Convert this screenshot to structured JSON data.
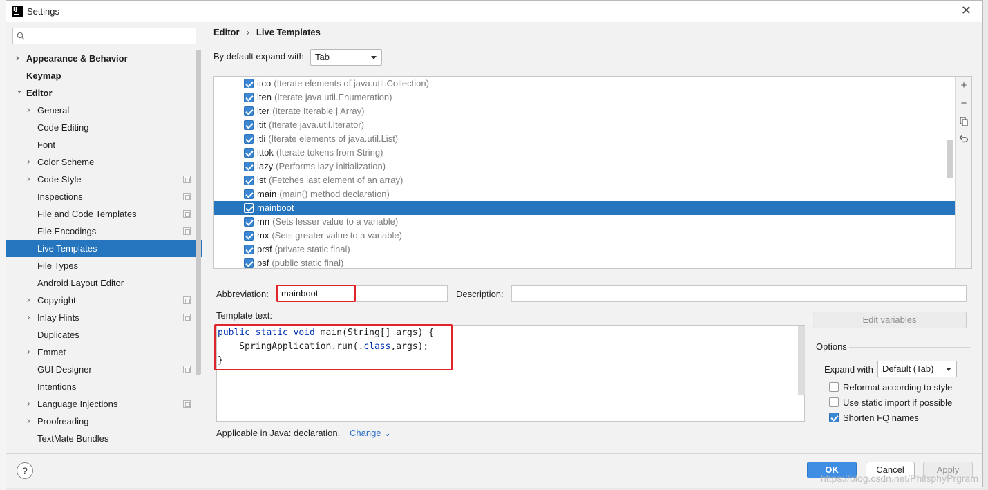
{
  "window": {
    "title": "Settings",
    "close_label": "✕"
  },
  "sidebar": {
    "search_placeholder": "",
    "items": [
      {
        "label": "Appearance & Behavior",
        "bold": true,
        "arrow": "›",
        "indent": 0
      },
      {
        "label": "Keymap",
        "bold": true,
        "arrow": "",
        "indent": 0
      },
      {
        "label": "Editor",
        "bold": true,
        "arrow": "⌄",
        "indent": 0
      },
      {
        "label": "General",
        "arrow": "›",
        "indent": 1
      },
      {
        "label": "Code Editing",
        "arrow": "",
        "indent": 1
      },
      {
        "label": "Font",
        "arrow": "",
        "indent": 1
      },
      {
        "label": "Color Scheme",
        "arrow": "›",
        "indent": 1
      },
      {
        "label": "Code Style",
        "arrow": "›",
        "indent": 1,
        "proj": true
      },
      {
        "label": "Inspections",
        "arrow": "",
        "indent": 1,
        "proj": true
      },
      {
        "label": "File and Code Templates",
        "arrow": "",
        "indent": 1,
        "proj": true
      },
      {
        "label": "File Encodings",
        "arrow": "",
        "indent": 1,
        "proj": true
      },
      {
        "label": "Live Templates",
        "arrow": "",
        "indent": 1,
        "selected": true
      },
      {
        "label": "File Types",
        "arrow": "",
        "indent": 1
      },
      {
        "label": "Android Layout Editor",
        "arrow": "",
        "indent": 1
      },
      {
        "label": "Copyright",
        "arrow": "›",
        "indent": 1,
        "proj": true
      },
      {
        "label": "Inlay Hints",
        "arrow": "›",
        "indent": 1,
        "proj": true
      },
      {
        "label": "Duplicates",
        "arrow": "",
        "indent": 1
      },
      {
        "label": "Emmet",
        "arrow": "›",
        "indent": 1
      },
      {
        "label": "GUI Designer",
        "arrow": "",
        "indent": 1,
        "proj": true
      },
      {
        "label": "Intentions",
        "arrow": "",
        "indent": 1
      },
      {
        "label": "Language Injections",
        "arrow": "›",
        "indent": 1,
        "proj": true
      },
      {
        "label": "Proofreading",
        "arrow": "›",
        "indent": 1
      },
      {
        "label": "TextMate Bundles",
        "arrow": "",
        "indent": 1
      }
    ]
  },
  "breadcrumb": {
    "parent": "Editor",
    "separator": "›",
    "current": "Live Templates"
  },
  "expand": {
    "label": "By default expand with",
    "value": "Tab"
  },
  "templates": [
    {
      "name": "itco",
      "desc": "(Iterate elements of java.util.Collection)",
      "checked": true
    },
    {
      "name": "iten",
      "desc": "(Iterate java.util.Enumeration)",
      "checked": true
    },
    {
      "name": "iter",
      "desc": "(Iterate Iterable | Array)",
      "checked": true
    },
    {
      "name": "itit",
      "desc": "(Iterate java.util.Iterator)",
      "checked": true
    },
    {
      "name": "itli",
      "desc": "(Iterate elements of java.util.List)",
      "checked": true
    },
    {
      "name": "ittok",
      "desc": "(Iterate tokens from String)",
      "checked": true
    },
    {
      "name": "lazy",
      "desc": "(Performs lazy initialization)",
      "checked": true
    },
    {
      "name": "lst",
      "desc": "(Fetches last element of an array)",
      "checked": true
    },
    {
      "name": "main",
      "desc": "(main() method declaration)",
      "checked": true
    },
    {
      "name": "mainboot",
      "desc": "",
      "checked": true,
      "selected": true
    },
    {
      "name": "mn",
      "desc": "(Sets lesser value to a variable)",
      "checked": true
    },
    {
      "name": "mx",
      "desc": "(Sets greater value to a variable)",
      "checked": true
    },
    {
      "name": "prsf",
      "desc": "(private static final)",
      "checked": true
    },
    {
      "name": "psf",
      "desc": "(public static final)",
      "checked": true
    }
  ],
  "list_tools": [
    "+",
    "−",
    "copy-icon",
    "revert-icon"
  ],
  "abbreviation": {
    "label": "Abbreviation:",
    "value": "mainboot"
  },
  "description": {
    "label": "Description:",
    "value": ""
  },
  "template_text": {
    "label": "Template text:",
    "lines": [
      {
        "kw": "public static void",
        "rest": " main(String[] args) {"
      },
      {
        "kw": "",
        "pre": "    SpringApplication.run(.",
        "kw2": "class",
        "rest": ",args);"
      },
      {
        "kw": "",
        "rest": "}"
      }
    ]
  },
  "edit_variables_label": "Edit variables",
  "options": {
    "title": "Options",
    "expand_with_label": "Expand with",
    "expand_with_value": "Default (Tab)",
    "checks": [
      {
        "label": "Reformat according to style",
        "checked": false
      },
      {
        "label": "Use static import if possible",
        "checked": false
      },
      {
        "label": "Shorten FQ names",
        "checked": true
      }
    ]
  },
  "applicable": {
    "text": "Applicable in Java: declaration.",
    "change_label": "Change ⌄"
  },
  "footer": {
    "help_label": "?",
    "ok_label": "OK",
    "cancel_label": "Cancel",
    "apply_label": "Apply",
    "watermark": "https://blog.csdn.net/PhilsphyPrgram"
  },
  "colors": {
    "selection": "#2675bf",
    "accent": "#3b87d3",
    "red_highlight": "#e0242a",
    "keyword": "#0033b3"
  }
}
